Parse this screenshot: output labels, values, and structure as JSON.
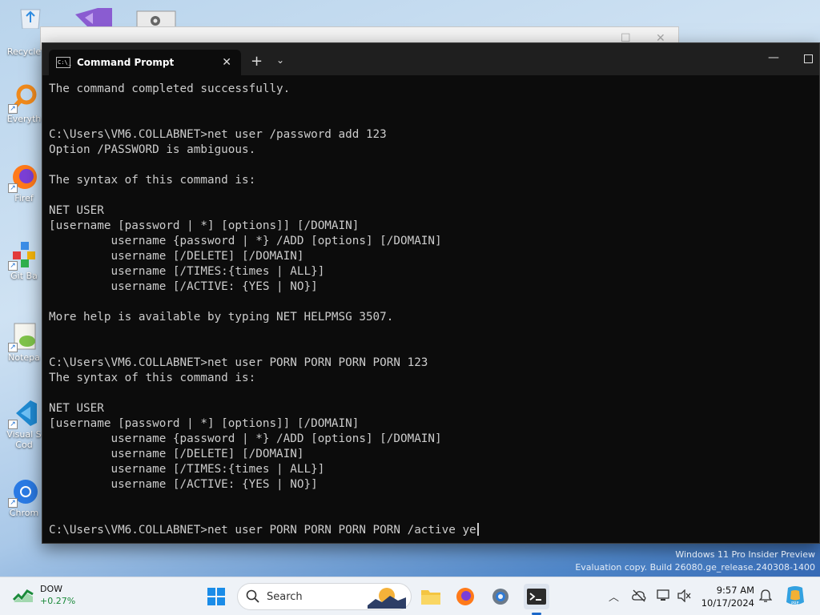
{
  "desktop": {
    "icons": [
      {
        "label": "Recycle",
        "icon": "recycle-bin-icon"
      },
      {
        "label": "Everyth",
        "icon": "everything-search-icon"
      },
      {
        "label": "Firef",
        "icon": "firefox-icon"
      },
      {
        "label": "Git Ba",
        "icon": "git-bash-icon"
      },
      {
        "label": "Notepa",
        "icon": "notepad-plus-plus-icon"
      },
      {
        "label": "Visual S",
        "label2": "Cod",
        "icon": "vscode-icon"
      },
      {
        "label": "Chrom",
        "icon": "chrome-icon"
      }
    ],
    "watermark_line1": "Windows 11 Pro Insider Preview",
    "watermark_line2": "Evaluation copy. Build 26080.ge_release.240308-1400"
  },
  "terminal": {
    "tab_title": "Command Prompt",
    "tab_icon_text": "C:\\_",
    "lines": [
      "The command completed successfully.",
      "",
      "",
      "C:\\Users\\VM6.COLLABNET>net user /password add 123",
      "Option /PASSWORD is ambiguous.",
      "",
      "The syntax of this command is:",
      "",
      "NET USER",
      "[username [password | *] [options]] [/DOMAIN]",
      "         username {password | *} /ADD [options] [/DOMAIN]",
      "         username [/DELETE] [/DOMAIN]",
      "         username [/TIMES:{times | ALL}]",
      "         username [/ACTIVE: {YES | NO}]",
      "",
      "More help is available by typing NET HELPMSG 3507.",
      "",
      "",
      "C:\\Users\\VM6.COLLABNET>net user PORN PORN PORN PORN 123",
      "The syntax of this command is:",
      "",
      "NET USER",
      "[username [password | *] [options]] [/DOMAIN]",
      "         username {password | *} /ADD [options] [/DOMAIN]",
      "         username [/DELETE] [/DOMAIN]",
      "         username [/TIMES:{times | ALL}]",
      "         username [/ACTIVE: {YES | NO}]",
      "",
      ""
    ],
    "prompt_line": "C:\\Users\\VM6.COLLABNET>net user PORN PORN PORN PORN /active ye"
  },
  "taskbar": {
    "widget_name": "DOW",
    "widget_change": "+0.27%",
    "search_label": "Search",
    "time": "9:57 AM",
    "date": "10/17/2024",
    "accent": "#1a67c9"
  }
}
